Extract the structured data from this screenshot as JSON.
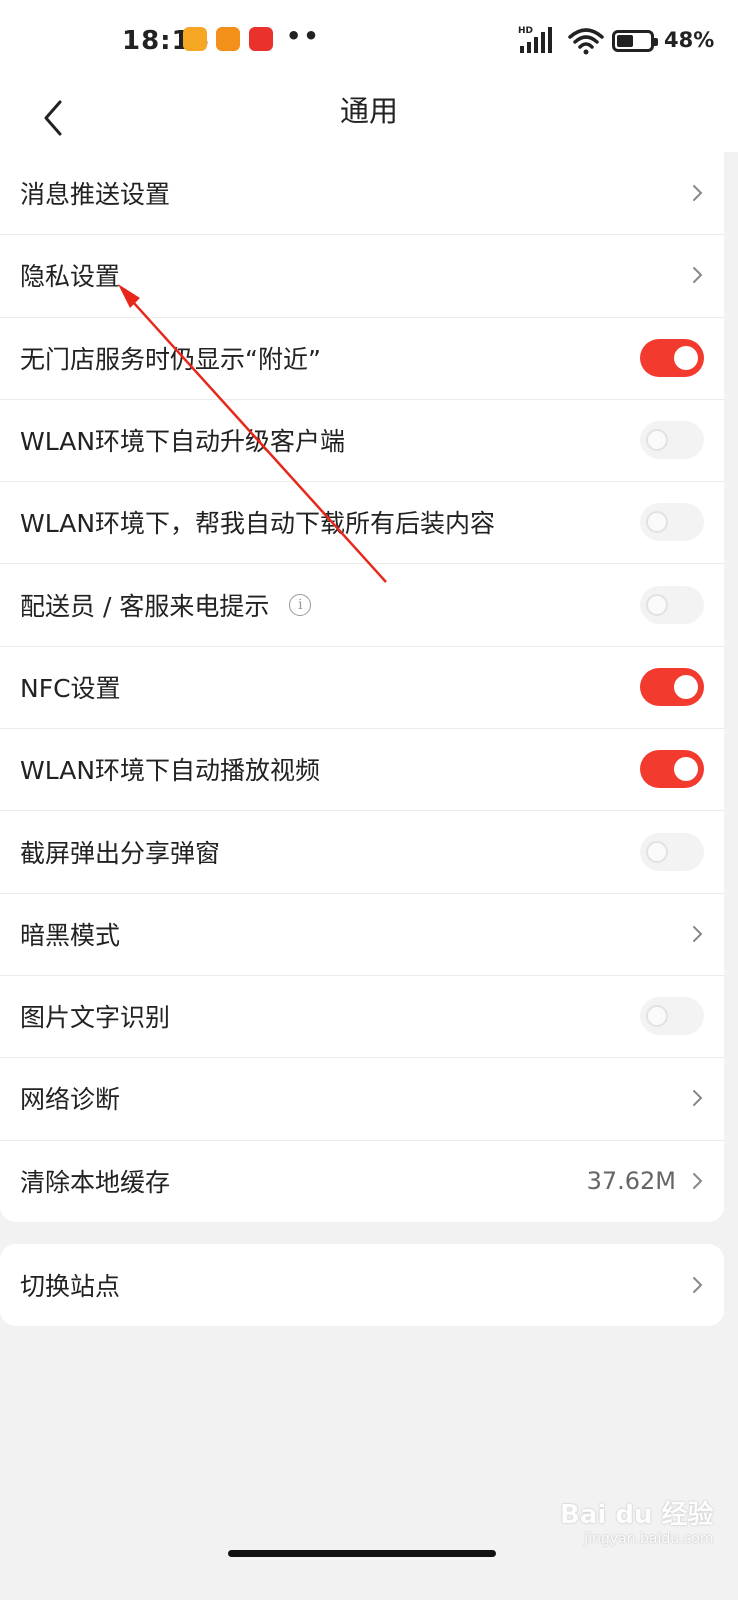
{
  "status_bar": {
    "time": "18:16",
    "dots": "••",
    "battery": "48%",
    "icons": [
      "app-notification-icon",
      "app-notification-icon",
      "app-notification-icon",
      "signal-icon",
      "wifi-icon",
      "battery-icon"
    ]
  },
  "navbar": {
    "title": "通用",
    "back_icon": "chevron-left-icon"
  },
  "settings": [
    {
      "label": "消息推送设置",
      "control": "chevron"
    },
    {
      "label": "隐私设置",
      "control": "chevron"
    },
    {
      "label": "无门店服务时仍显示“附近”",
      "control": "toggle",
      "on": true
    },
    {
      "label": "WLAN环境下自动升级客户端",
      "control": "toggle",
      "on": false
    },
    {
      "label": "WLAN环境下，帮我自动下载所有后装内容",
      "control": "toggle",
      "on": false
    },
    {
      "label": "配送员 / 客服来电提示",
      "control": "toggle",
      "on": false,
      "info_icon": "i"
    },
    {
      "label": "NFC设置",
      "control": "toggle",
      "on": true
    },
    {
      "label": "WLAN环境下自动播放视频",
      "control": "toggle",
      "on": true
    },
    {
      "label": "截屏弹出分享弹窗",
      "control": "toggle",
      "on": false
    },
    {
      "label": "暗黑模式",
      "control": "chevron"
    },
    {
      "label": "图片文字识别",
      "control": "toggle",
      "on": false
    },
    {
      "label": "网络诊断",
      "control": "chevron"
    },
    {
      "label": "清除本地缓存",
      "control": "chevron",
      "value": "37.62M"
    }
  ],
  "settings2": [
    {
      "label": "切换站点",
      "control": "chevron"
    }
  ],
  "colors": {
    "accent": "#f23a2f",
    "background": "#f2f2f2",
    "card": "#ffffff"
  },
  "watermark": {
    "text": "Bai du 经验",
    "sub": "jingyan.baidu.com"
  }
}
